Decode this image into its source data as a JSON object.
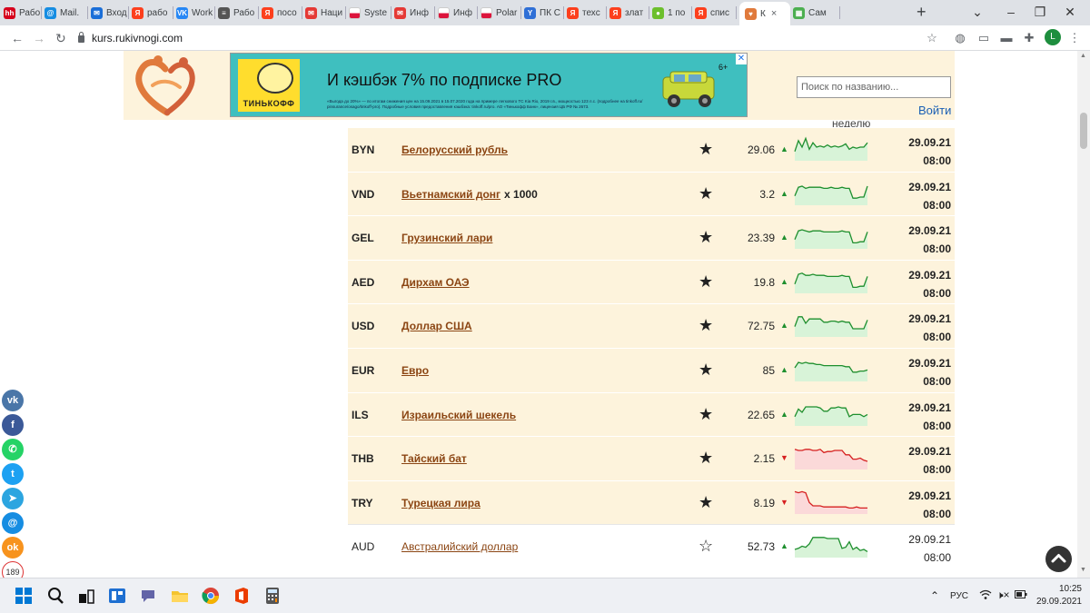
{
  "browser": {
    "tabs": [
      {
        "label": "Рабо",
        "favicon": "hh-icon",
        "color": "#d6001c",
        "glyph": "hh"
      },
      {
        "label": "Mail.",
        "favicon": "mail-ru-icon",
        "color": "#168de2",
        "glyph": "@"
      },
      {
        "label": "Вход",
        "favicon": "mail-envelope-icon",
        "color": "#1a6ed8",
        "glyph": "✉"
      },
      {
        "label": "рабо",
        "favicon": "yandex-icon",
        "color": "#fc3f1d",
        "glyph": "Я"
      },
      {
        "label": "Work",
        "favicon": "vk-icon",
        "color": "#2787f5",
        "glyph": "VK"
      },
      {
        "label": "Рабо",
        "favicon": "document-icon",
        "color": "#555555",
        "glyph": "≡"
      },
      {
        "label": "посо",
        "favicon": "yandex-icon",
        "color": "#fc3f1d",
        "glyph": "Я"
      },
      {
        "label": "Наци",
        "favicon": "mchs-icon",
        "color": "#e53935",
        "glyph": "✉"
      },
      {
        "label": "Syste",
        "favicon": "poland-flag-icon",
        "color": "#dc143c",
        "glyph": ""
      },
      {
        "label": "Инф",
        "favicon": "mchs-icon",
        "color": "#e53935",
        "glyph": "✉"
      },
      {
        "label": "Инф",
        "favicon": "poland-flag-icon",
        "color": "#dc143c",
        "glyph": ""
      },
      {
        "label": "Polar",
        "favicon": "poland-flag-icon",
        "color": "#dc143c",
        "glyph": ""
      },
      {
        "label": "ПК С",
        "favicon": "yandex-market-icon",
        "color": "#2f6fd6",
        "glyph": "Y"
      },
      {
        "label": "техс",
        "favicon": "yandex-icon",
        "color": "#fc3f1d",
        "glyph": "Я"
      },
      {
        "label": "злат",
        "favicon": "yandex-icon",
        "color": "#fc3f1d",
        "glyph": "Я"
      },
      {
        "label": "1 по",
        "favicon": "ball-icon",
        "color": "#6cbf2c",
        "glyph": "●"
      },
      {
        "label": "спис",
        "favicon": "yandex-icon",
        "color": "#fc3f1d",
        "glyph": "Я"
      },
      {
        "label": "К",
        "favicon": "site-heart-icon",
        "color": "#e07a3c",
        "glyph": "♥",
        "active": true
      },
      {
        "label": "Сам",
        "favicon": "grid-icon",
        "color": "#4caf50",
        "glyph": "▦"
      }
    ],
    "new_tab": "+",
    "tab_close": "×",
    "url": "kurs.rukivnogi.com",
    "profile_letter": "L"
  },
  "site": {
    "banner": {
      "headline": "И кэшбэк 7% по подписке PRO",
      "brand": "ТИНЬКОФФ",
      "age": "6+",
      "fine_print": "«Выгода до 20%» — по итогам снижения цен на 15.09.2021 в 15.07.2020 года на примере легкового ТС Kia Rio, 2019 г.в., мощностью 123 л.с. (подробнее на tinkoff.ru/ pinsurance/osago/tinkoff-pro). Подробные условия предоставления кэшбэка: tinkoff.ru/pro. АО «Тинькофф Банк», лицензия ЦБ РФ № 2673.",
      "close": "✕"
    },
    "search_placeholder": "Поиск по названию...",
    "login": "Войти",
    "week_label": "неделю"
  },
  "rates": [
    {
      "code": "BYN",
      "name": "Белорусский рубль",
      "suffix": "",
      "favorite": true,
      "rate": "29.06",
      "trend": "up",
      "date": "29.09.21",
      "time": "08:00",
      "spark": [
        14,
        4,
        10,
        2,
        12,
        6,
        10,
        9,
        10,
        8,
        10,
        9,
        10,
        9,
        7,
        12,
        10,
        11,
        10,
        10,
        6
      ]
    },
    {
      "code": "VND",
      "name": "Вьетнамский донг",
      "suffix": "x 1000",
      "favorite": true,
      "rate": "3.2",
      "trend": "up",
      "date": "29.09.21",
      "time": "08:00",
      "spark": [
        14,
        6,
        5,
        7,
        6,
        6,
        6,
        6,
        7,
        7,
        6,
        7,
        7,
        6,
        7,
        7,
        16,
        16,
        15,
        15,
        5
      ]
    },
    {
      "code": "GEL",
      "name": "Грузинский лари",
      "suffix": "",
      "favorite": true,
      "rate": "23.39",
      "trend": "up",
      "date": "29.09.21",
      "time": "08:00",
      "spark": [
        14,
        6,
        5,
        6,
        7,
        6,
        6,
        6,
        7,
        7,
        7,
        7,
        7,
        6,
        7,
        7,
        17,
        17,
        16,
        16,
        7
      ]
    },
    {
      "code": "AED",
      "name": "Дирхам ОАЭ",
      "suffix": "",
      "favorite": true,
      "rate": "19.8",
      "trend": "up",
      "date": "29.09.21",
      "time": "08:00",
      "spark": [
        14,
        5,
        4,
        6,
        6,
        5,
        6,
        6,
        6,
        7,
        7,
        7,
        7,
        6,
        7,
        7,
        17,
        17,
        16,
        16,
        7
      ]
    },
    {
      "code": "USD",
      "name": "Доллар США",
      "suffix": "",
      "favorite": true,
      "rate": "72.75",
      "trend": "up",
      "date": "29.09.21",
      "time": "08:00",
      "spark": [
        13,
        4,
        4,
        10,
        6,
        6,
        6,
        6,
        9,
        9,
        8,
        8,
        9,
        8,
        9,
        9,
        15,
        15,
        15,
        15,
        7
      ]
    },
    {
      "code": "EUR",
      "name": "Евро",
      "suffix": "",
      "favorite": true,
      "rate": "85",
      "trend": "up",
      "date": "29.09.21",
      "time": "08:00",
      "spark": [
        10,
        5,
        6,
        5,
        6,
        6,
        7,
        7,
        8,
        8,
        8,
        8,
        8,
        8,
        9,
        9,
        14,
        14,
        13,
        13,
        12
      ]
    },
    {
      "code": "ILS",
      "name": "Израильский шекель",
      "suffix": "",
      "favorite": true,
      "rate": "22.65",
      "trend": "up",
      "date": "29.09.21",
      "time": "08:00",
      "spark": [
        14,
        7,
        10,
        5,
        5,
        5,
        5,
        6,
        9,
        9,
        6,
        6,
        5,
        6,
        6,
        14,
        12,
        12,
        12,
        14,
        12
      ]
    },
    {
      "code": "THB",
      "name": "Тайский бат",
      "suffix": "",
      "favorite": true,
      "rate": "2.15",
      "trend": "down",
      "date": "29.09.21",
      "time": "08:00",
      "spark": [
        4,
        5,
        5,
        4,
        4,
        5,
        5,
        4,
        7,
        6,
        6,
        5,
        5,
        5,
        9,
        9,
        13,
        13,
        12,
        14,
        15
      ]
    },
    {
      "code": "TRY",
      "name": "Турецкая лира",
      "suffix": "",
      "favorite": true,
      "rate": "8.19",
      "trend": "down",
      "date": "29.09.21",
      "time": "08:00",
      "spark": [
        2,
        3,
        2,
        3,
        12,
        15,
        15,
        15,
        16,
        16,
        16,
        16,
        16,
        16,
        16,
        17,
        17,
        16,
        17,
        17,
        17
      ]
    },
    {
      "code": "AUD",
      "name": "Австралийский доллар",
      "suffix": "",
      "favorite": false,
      "rate": "52.73",
      "trend": "up",
      "date": "29.09.21",
      "time": "08:00",
      "spark": [
        15,
        14,
        12,
        13,
        10,
        4,
        4,
        4,
        4,
        5,
        5,
        5,
        5,
        14,
        13,
        8,
        15,
        13,
        16,
        15,
        17
      ]
    }
  ],
  "share": [
    {
      "name": "vk",
      "color": "#4a76a8",
      "glyph": "vk"
    },
    {
      "name": "facebook",
      "color": "#3b5998",
      "glyph": "f"
    },
    {
      "name": "whatsapp",
      "color": "#25d366",
      "glyph": "✆"
    },
    {
      "name": "twitter",
      "color": "#1da1f2",
      "glyph": "t"
    },
    {
      "name": "telegram",
      "color": "#2ca5e0",
      "glyph": "➤"
    },
    {
      "name": "email",
      "color": "#168de2",
      "glyph": "@"
    },
    {
      "name": "odnoklassniki",
      "color": "#f7931e",
      "glyph": "ok"
    }
  ],
  "share_count": "189",
  "to_top": "^",
  "taskbar": {
    "lang": "РУС",
    "time": "10:25",
    "date": "29.09.2021"
  },
  "colors": {
    "up": "#1e8f2e",
    "down": "#d62020",
    "up_fill": "#d8f3d8",
    "down_fill": "#fbd9d9",
    "row_bg": "#fdf3dc"
  }
}
